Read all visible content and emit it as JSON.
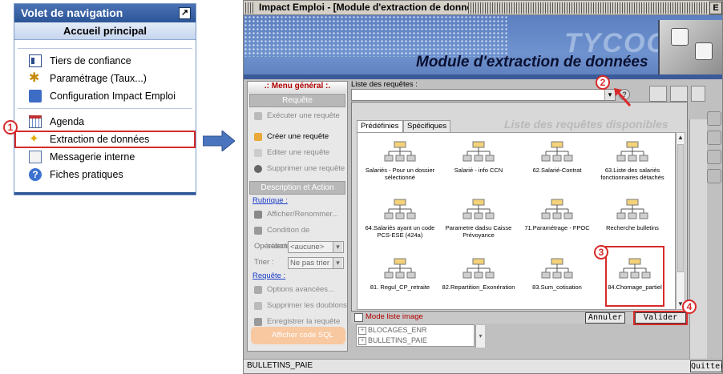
{
  "nav": {
    "title": "Volet de navigation",
    "subtitle": "Accueil principal",
    "pin_icon": "pin-icon",
    "items": [
      {
        "label": "Tiers de confiance",
        "icon": "card-icon"
      },
      {
        "label": "Paramétrage (Taux...)",
        "icon": "gear-icon"
      },
      {
        "label": "Configuration Impact Emploi",
        "icon": "config-icon"
      },
      {
        "label": "Agenda",
        "icon": "calendar-icon"
      },
      {
        "label": "Extraction de données",
        "icon": "extraction-icon"
      },
      {
        "label": "Messagerie interne",
        "icon": "mail-icon"
      },
      {
        "label": "Fiches pratiques",
        "icon": "help-icon"
      }
    ]
  },
  "badges": [
    "1",
    "2",
    "3",
    "4"
  ],
  "window": {
    "title": "Impact Emploi - [Module d'extraction de données]",
    "close": "E",
    "brand": "TYCOON",
    "module_title": "Module d'extraction de données"
  },
  "menu": {
    "header": ".: Menu général :.",
    "section_requete": "Requête",
    "exec": "Exécuter une requête",
    "create": "Créer une requête",
    "edit": "Editer une requête",
    "delete": "Supprimer une requête",
    "section_desc": "Description et Action",
    "rubrique": "Rubrique :",
    "afficher": "Afficher/Renommer...",
    "condition": "Condition de sélection...",
    "operation_label": "Opération :",
    "operation_value": "<aucune>",
    "trier_label": "Trier :",
    "trier_value": "Ne pas trier",
    "requete_link": "Requête :",
    "options": "Options avancées...",
    "doublons": "Supprimer les doublons",
    "enregistrer": "Enregistrer la requête",
    "sql": "Afficher code SQL"
  },
  "main": {
    "list_label": "Liste des requêtes :",
    "help": "?",
    "tabs": [
      "Prédéfinies",
      "Spécifiques"
    ],
    "panel_title": "Liste des requêtes disponibles",
    "tiles": [
      "Salariés - Pour un dossier sélectionné",
      "Salarié - info CCN",
      "62.Salarié-Contrat",
      "63.Liste des salariés fonctionnaires détachés",
      "64.Salariés ayant un code PCS-ESE (424a)",
      "Parametre dadsu Caisse Prévoyance",
      "71.Paramétrage - FPOC",
      "Recherche bulletins",
      "81. Regul_CP_retraite",
      "82.Repartition_Exonération",
      "83.Sum_cotisation",
      "84.Chomage_partiel"
    ],
    "mode_liste": "Mode liste image",
    "annuler": "Annuler",
    "valider": "Valider",
    "tree": [
      "BLOCAGES_ENR",
      "BULLETINS_PAIE"
    ]
  },
  "status": {
    "text": "BULLETINS_PAIE",
    "quit": "Quitter"
  },
  "colors": {
    "highlight": "#d72a2a",
    "nav_header": "#2c5597",
    "banner": "#6f93cf"
  }
}
